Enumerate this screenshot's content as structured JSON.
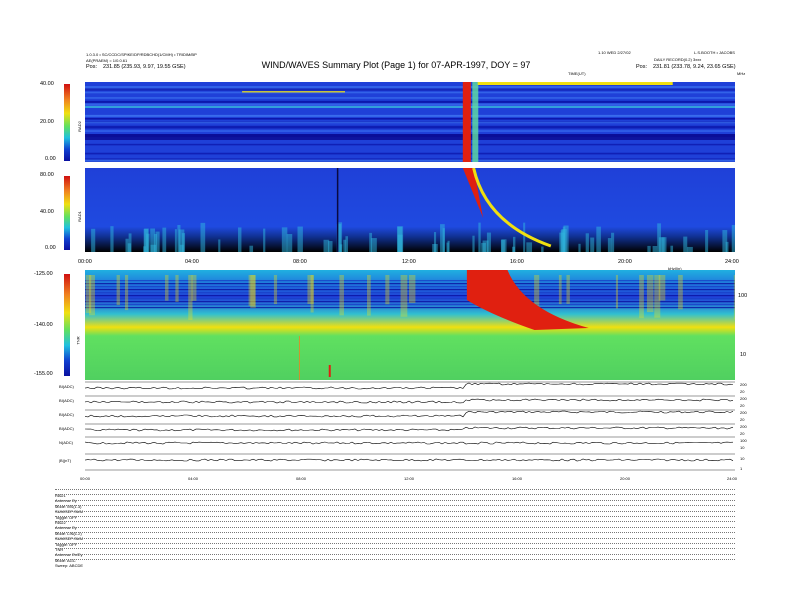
{
  "header": {
    "left_line1": "1.0.3.0 • SC/CCDC/SPIKE/DP/RDBCHD(1/CMH) • TRIDIM/BP",
    "left_line2": "AE(PRAEM) = 1/0.0.61",
    "left_pos_label": "Pos:",
    "left_pos_value": "231.85 (235.93, 9.97, 19.55 GSE)",
    "title": "WIND/WAVES Summary Plot (Page 1) for 07-APR-1997, DOY = 97",
    "right_line1a": "1.10 WED 2/27/02",
    "right_line1b": "L.S.BOOTH • JACOBS",
    "right_line2": "DAILY RECORD(0.2) 3xxx",
    "right_pos_label": "Pos:",
    "right_pos_value": "231.81 (233.78, 9.24, 23.65 GSE)",
    "ut_label": "TIME(UT)",
    "mhz_label": "MHz"
  },
  "rad2": {
    "label": "RAD2",
    "ticks": [
      "40.00",
      "20.00",
      "0.00"
    ]
  },
  "rad1": {
    "label": "RAD1",
    "ticks": [
      "80.00",
      "40.00",
      "0.00"
    ]
  },
  "tnr": {
    "label": "TNR",
    "ticks": [
      "-125.00",
      "-140.00",
      "-155.00"
    ],
    "right_ticks": [
      "100",
      "10"
    ],
    "khz_label": "kHz(lin)"
  },
  "time_axis": [
    "00:00",
    "04:00",
    "08:00",
    "12:00",
    "16:00",
    "20:00",
    "24:00"
  ],
  "mag": {
    "labels": [
      "BI(ADC)",
      "BI(ADC)",
      "BI(ADC)",
      "BI(ADC)",
      "N(ADC)",
      "|B|(nT)"
    ],
    "right_scale": [
      "200",
      "20",
      "200",
      "20",
      "200",
      "20",
      "200",
      "20",
      "100",
      "10",
      "10",
      "1"
    ]
  },
  "status": {
    "rows": [
      "RAD1",
      "Antenna:  Ey",
      "Mode:  MS(1.3)",
      "SUM/SEP:SUM",
      "Toggle:  OFF",
      "RAD2",
      "Antenna:  Ey",
      "Mode:  LIN(1.2)",
      "SUM/SEP:SUM",
      "Toggle:  OFF",
      "TNR",
      "Antenna:  Ex/Ey",
      "Mode:  AGC",
      "Sweep: ABCDE"
    ]
  },
  "chart_data": {
    "type": "heatmap",
    "title": "WIND/WAVES Summary Plot (Page 1) for 07-APR-1997, DOY = 97",
    "xlabel": "TIME(UT)",
    "x_range_hours": [
      0,
      24
    ],
    "panels": [
      {
        "name": "RAD2",
        "colorbar_ticks": [
          40,
          20,
          0
        ]
      },
      {
        "name": "RAD1",
        "colorbar_ticks": [
          80,
          40,
          0
        ]
      },
      {
        "name": "TNR",
        "colorbar_ticks": [
          -125,
          -140,
          -155
        ],
        "freq_axis_ticks": [
          100,
          10
        ]
      }
    ],
    "events": [
      {
        "type": "type-II/III burst onset",
        "time_hours": 14.0
      },
      {
        "type": "spike",
        "time_hours": 9.3
      }
    ],
    "colors": {
      "low": "#0a1ab0",
      "mid": "#39c8d0",
      "high_green": "#6fe070",
      "yellow": "#f2e800",
      "red": "#e0201a"
    }
  }
}
